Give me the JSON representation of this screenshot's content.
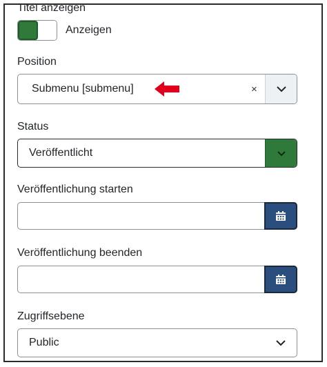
{
  "title_toggle": {
    "label": "Titel anzeigen",
    "state_text": "Anzeigen",
    "on": true
  },
  "position": {
    "label": "Position",
    "value": "Submenu [submenu]",
    "clear_glyph": "×",
    "annotation": "red-arrow-icon"
  },
  "status": {
    "label": "Status",
    "value": "Veröffentlicht",
    "accent": "#2f7a3a"
  },
  "publish_start": {
    "label": "Veröffentlichung starten",
    "value": ""
  },
  "publish_end": {
    "label": "Veröffentlichung beenden",
    "value": ""
  },
  "access": {
    "label": "Zugriffsebene",
    "value": "Public"
  },
  "colors": {
    "green": "#2f7a3a",
    "calendar_blue": "#2a4f7e",
    "arrow_red": "#e0001b"
  }
}
